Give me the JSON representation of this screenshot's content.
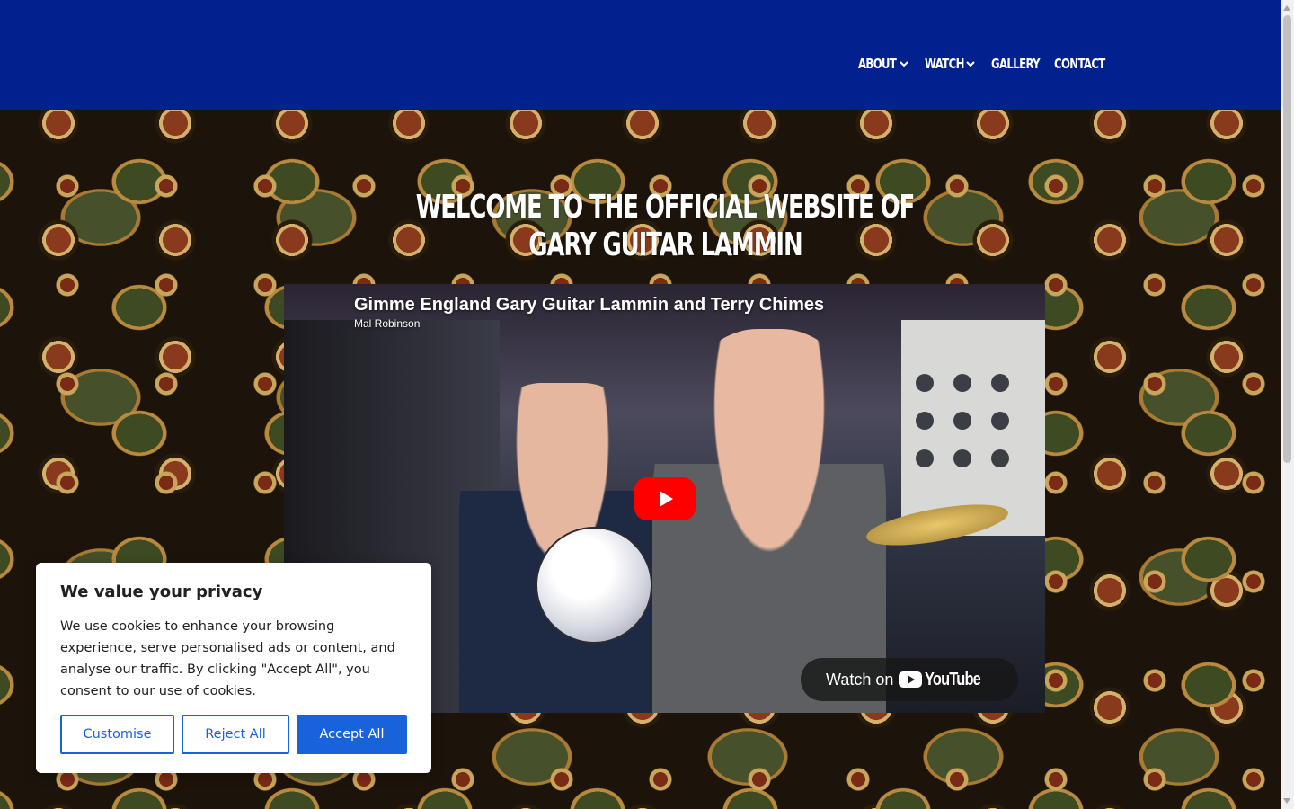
{
  "header": {
    "nav": [
      {
        "label": "ABOUT",
        "has_dropdown": true
      },
      {
        "label": "WATCH",
        "has_dropdown": true
      },
      {
        "label": "GALLERY",
        "has_dropdown": false
      },
      {
        "label": "CONTACT",
        "has_dropdown": false
      }
    ],
    "background_color": "#02218f"
  },
  "hero": {
    "title_line1": "WELCOME TO THE OFFICIAL WEBSITE OF",
    "title_line2": "GARY GUITAR LAMMIN"
  },
  "video": {
    "title": "Gimme England Gary Guitar Lammin and Terry Chimes",
    "channel": "Mal Robinson",
    "watch_on_label": "Watch on",
    "platform_word": "YouTube",
    "play_icon": "play-icon"
  },
  "cookie": {
    "title": "We value your privacy",
    "text": "We use cookies to enhance your browsing experience, serve personalised ads or content, and analyse our traffic. By clicking \"Accept All\", you consent to our use of cookies.",
    "buttons": {
      "customise": "Customise",
      "reject": "Reject All",
      "accept": "Accept All"
    },
    "accent_color": "#1863dc"
  }
}
